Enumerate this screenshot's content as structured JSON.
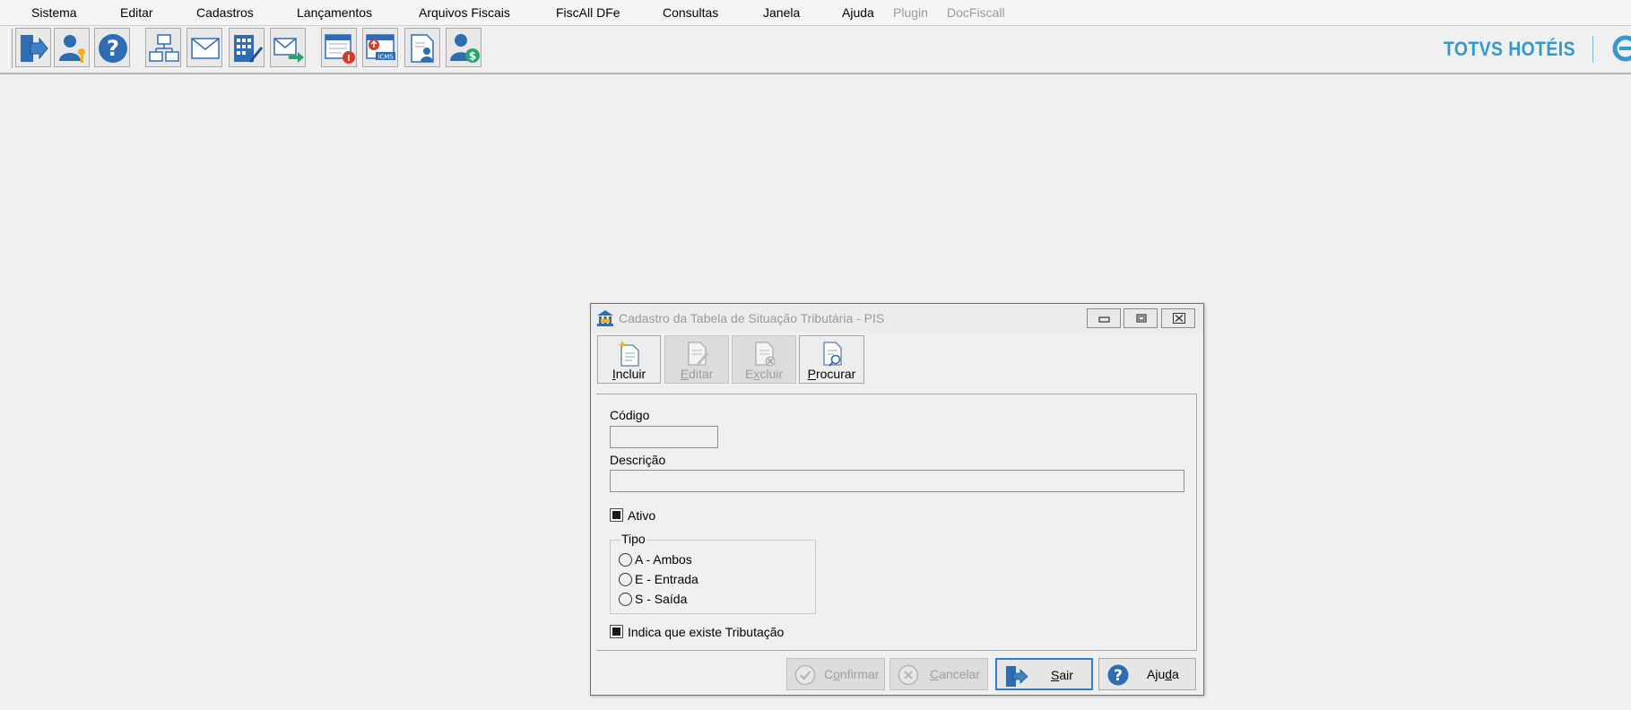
{
  "menu": [
    {
      "label": "Sistema",
      "enabled": true
    },
    {
      "label": "Editar",
      "enabled": true
    },
    {
      "label": "Cadastros",
      "enabled": true
    },
    {
      "label": "Lançamentos",
      "enabled": true
    },
    {
      "label": "Arquivos Fiscais",
      "enabled": true
    },
    {
      "label": "FiscAll DFe",
      "enabled": true
    },
    {
      "label": "Consultas",
      "enabled": true
    },
    {
      "label": "Janela",
      "enabled": true
    },
    {
      "label": "Ajuda",
      "enabled": true
    },
    {
      "label": "Plugin",
      "enabled": false
    },
    {
      "label": "DocFiscall",
      "enabled": false
    }
  ],
  "toolbar": {
    "icons": [
      "exit-icon",
      "user-key-icon",
      "help-icon",
      "org-chart-icon",
      "mail-icon",
      "calculator-edit-icon",
      "mail-send-icon",
      "calendar-alert-icon",
      "calendar-icms-icon",
      "document-user-icon",
      "user-money-icon"
    ],
    "brand": "TOTVS HOTÉIS",
    "brand_color": "#3399cc"
  },
  "dialog": {
    "title": "Cadastro da Tabela de Situação Tributária - PIS",
    "tools": [
      {
        "mnemonic": "I",
        "rest": "ncluir",
        "enabled": true
      },
      {
        "mnemonic": "E",
        "rest": "ditar",
        "enabled": false
      },
      {
        "mnemonic": "x",
        "prefix": "E",
        "rest": "cluir",
        "enabled": false
      },
      {
        "mnemonic": "P",
        "rest": "rocurar",
        "enabled": true
      }
    ],
    "form": {
      "codigo_label": "Código",
      "codigo_value": "",
      "descricao_label": "Descrição",
      "descricao_value": "",
      "ativo_label": "Ativo",
      "ativo_checked": true,
      "tipo_label": "Tipo",
      "tipo_options": [
        "A - Ambos",
        "E - Entrada",
        "S - Saída"
      ],
      "tributacao_label": "Indica que existe Tributação",
      "tributacao_checked": true
    },
    "buttons": {
      "confirmar": {
        "prefix": "C",
        "mnemonic": "o",
        "rest": "nfirmar",
        "enabled": false
      },
      "cancelar": {
        "prefix": "",
        "mnemonic": "C",
        "rest": "ancelar",
        "enabled": false
      },
      "sair": {
        "prefix": "",
        "mnemonic": "S",
        "rest": "air",
        "enabled": true
      },
      "ajuda": {
        "prefix": "Aju",
        "mnemonic": "d",
        "rest": "a",
        "enabled": true
      }
    }
  }
}
